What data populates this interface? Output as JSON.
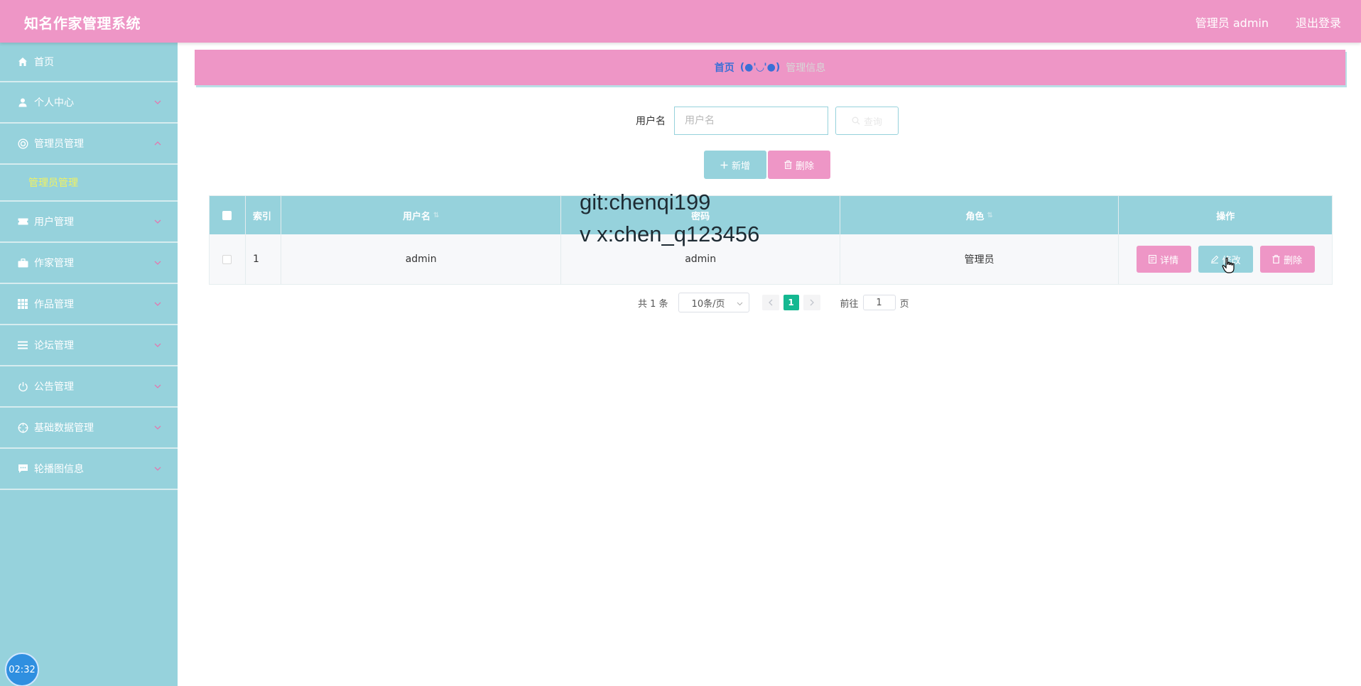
{
  "header": {
    "app_title": "知名作家管理系统",
    "user_info": "管理员 admin",
    "logout": "退出登录"
  },
  "sidebar": {
    "items": [
      {
        "label": "首页",
        "icon": "home-icon"
      },
      {
        "label": "个人中心",
        "icon": "user-icon"
      },
      {
        "label": "管理员管理",
        "icon": "admin-icon",
        "expanded": true
      },
      {
        "label": "用户管理",
        "icon": "ticket-icon"
      },
      {
        "label": "作家管理",
        "icon": "briefcase-icon"
      },
      {
        "label": "作品管理",
        "icon": "grid-icon"
      },
      {
        "label": "论坛管理",
        "icon": "list-icon"
      },
      {
        "label": "公告管理",
        "icon": "power-icon"
      },
      {
        "label": "基础数据管理",
        "icon": "crosshair-icon"
      },
      {
        "label": "轮播图信息",
        "icon": "message-icon"
      }
    ],
    "active_submenu": "管理员管理",
    "clock": "02:32"
  },
  "breadcrumb": {
    "home": "首页",
    "separator": "(●'◡'●)",
    "current": "管理信息"
  },
  "search": {
    "label": "用户名",
    "placeholder": "用户名",
    "query_button": "查询"
  },
  "actions": {
    "add": "新增",
    "delete": "删除"
  },
  "table": {
    "columns": [
      "索引",
      "用户名",
      "密码",
      "角色",
      "操作"
    ],
    "rows": [
      {
        "index": "1",
        "username": "admin",
        "password": "admin",
        "role": "管理员"
      }
    ],
    "row_actions": {
      "detail": "详情",
      "edit": "修改",
      "delete": "删除"
    }
  },
  "pagination": {
    "total": "共 1 条",
    "page_size": "10条/页",
    "current_page": "1",
    "goto_label": "前往",
    "goto_value": "1",
    "page_suffix": "页"
  },
  "watermark": {
    "line1": "git:chenqi199",
    "line2": "v x:chen_q123456"
  },
  "colors": {
    "pink": "#ee96c6",
    "teal": "#96d2dc",
    "submenu_active": "#f2f25e",
    "pager_active": "#14b891"
  }
}
